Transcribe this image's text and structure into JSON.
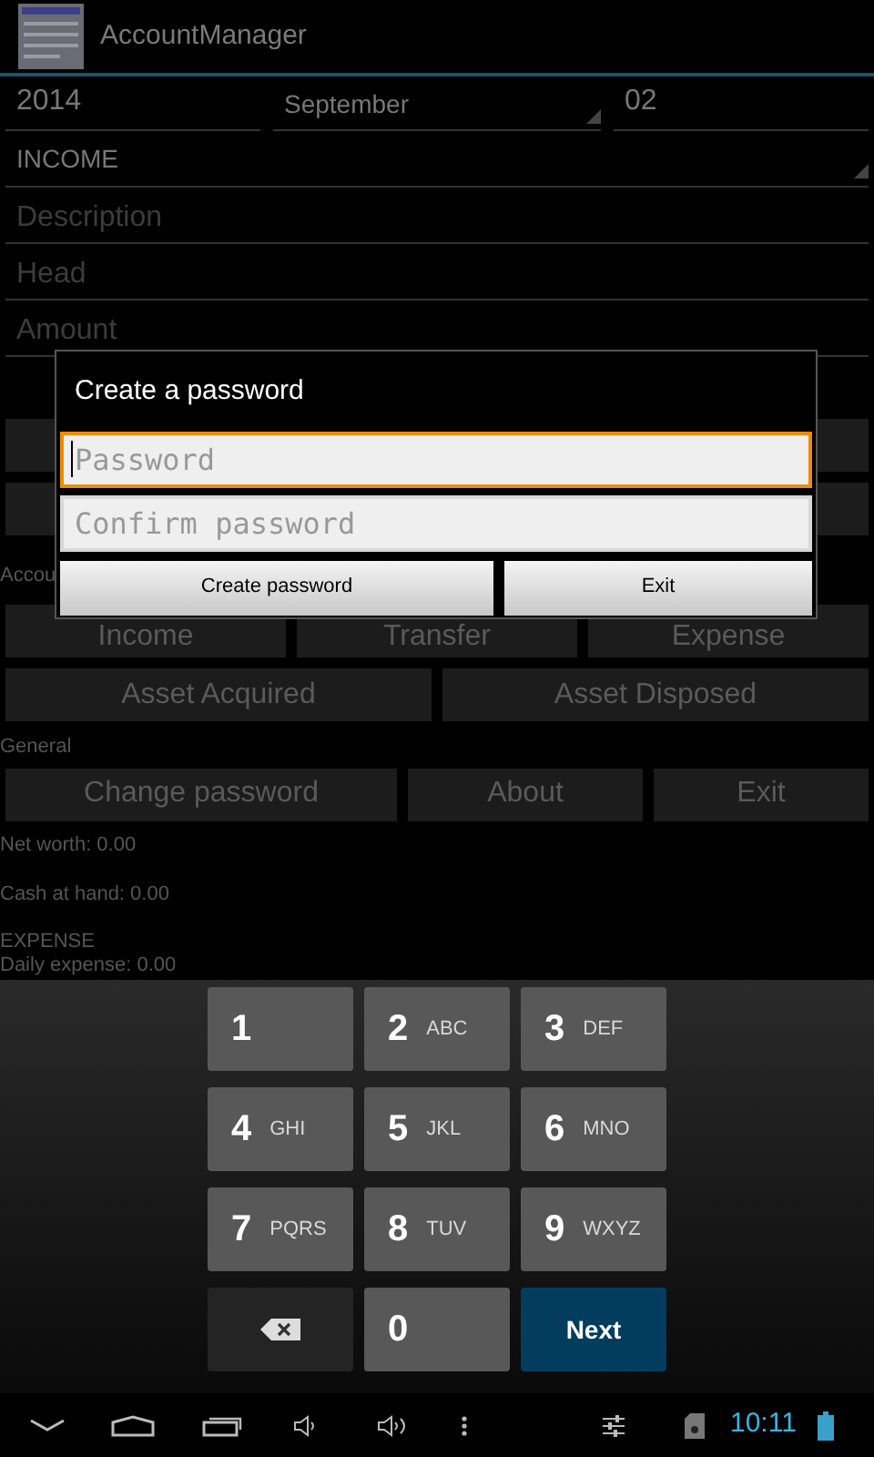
{
  "app_bar": {
    "title": "AccountManager"
  },
  "date": {
    "year": "2014",
    "month": "September",
    "day": "02"
  },
  "type_spinner": {
    "value": "INCOME"
  },
  "fields": [
    {
      "placeholder": "Description"
    },
    {
      "placeholder": "Head"
    },
    {
      "placeholder": "Amount"
    }
  ],
  "account_label": "Accou",
  "account_buttons": [
    [
      "Income",
      "Transfer",
      "Expense"
    ],
    [
      "Asset Acquired",
      "Asset Disposed"
    ]
  ],
  "general_label": "General",
  "general_buttons": [
    "Change password",
    "About",
    "Exit"
  ],
  "summary": [
    "Net worth: 0.00",
    "Cash at hand: 0.00"
  ],
  "expense": {
    "title": "EXPENSE",
    "daily": "Daily expense: 0.00"
  },
  "dialog": {
    "title": "Create a password",
    "fields": [
      {
        "placeholder": "Password",
        "focused": true
      },
      {
        "placeholder": "Confirm password",
        "focused": false
      }
    ],
    "buttons": [
      "Create password",
      "Exit"
    ]
  },
  "keypad": [
    {
      "kind": "digit",
      "digit": "1"
    },
    {
      "kind": "digit",
      "digit": "2",
      "letters": "ABC"
    },
    {
      "kind": "digit",
      "digit": "3",
      "letters": "DEF"
    },
    {
      "kind": "digit",
      "digit": "4",
      "letters": "GHI"
    },
    {
      "kind": "digit",
      "digit": "5",
      "letters": "JKL"
    },
    {
      "kind": "digit",
      "digit": "6",
      "letters": "MNO"
    },
    {
      "kind": "digit",
      "digit": "7",
      "letters": "PQRS"
    },
    {
      "kind": "digit",
      "digit": "8",
      "letters": "TUV"
    },
    {
      "kind": "digit",
      "digit": "9",
      "letters": "WXYZ"
    },
    {
      "kind": "delete"
    },
    {
      "kind": "digit",
      "digit": "0"
    },
    {
      "kind": "action",
      "label": "Next"
    }
  ],
  "status_bar": {
    "time": "10:11"
  }
}
